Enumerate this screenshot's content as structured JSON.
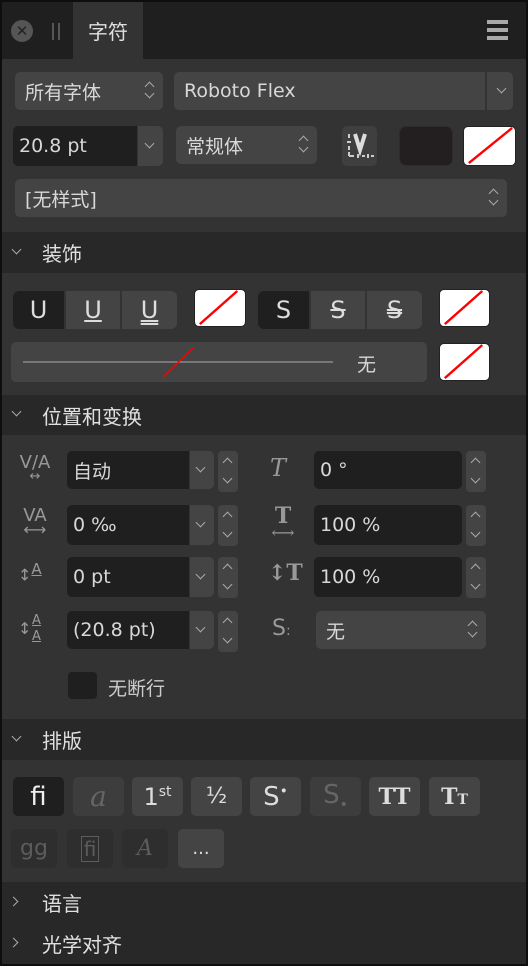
{
  "titlebar": {
    "tab_label": "字符"
  },
  "font": {
    "collection": "所有字体",
    "family": "Roboto Flex",
    "size": "20.8 pt",
    "style": "常规体",
    "text_style": "[无样式]"
  },
  "colors": {
    "fill": "#231f20",
    "none_stroke": "#ff0000"
  },
  "sections": {
    "decoration": "装饰",
    "position_transform": "位置和变换",
    "typography": "排版",
    "language": "语言",
    "optical_alignment": "光学对齐"
  },
  "decoration": {
    "underline_options": [
      "U",
      "U",
      "U"
    ],
    "strike_options": [
      "S",
      "S",
      "S"
    ],
    "line_style_value": "无"
  },
  "position": {
    "kerning": "自动",
    "shear": "0 °",
    "tracking": "0 ‰",
    "horizontal_scale": "100 %",
    "baseline": "0 pt",
    "vertical_scale": "100 %",
    "leading": "(20.8 pt)",
    "position_mode": "无",
    "no_break_label": "无断行"
  },
  "typography": {
    "features": [
      {
        "name": "standard-ligatures",
        "glyph": "fi"
      },
      {
        "name": "discretionary",
        "glyph": "a"
      },
      {
        "name": "ordinals",
        "glyph": "1st"
      },
      {
        "name": "fractions",
        "glyph": "½"
      },
      {
        "name": "superscript",
        "glyph": "S•"
      },
      {
        "name": "subscript",
        "glyph": "S."
      },
      {
        "name": "all-caps",
        "glyph": "TT"
      },
      {
        "name": "small-caps",
        "glyph": "Tт"
      }
    ],
    "more_label": "..."
  }
}
